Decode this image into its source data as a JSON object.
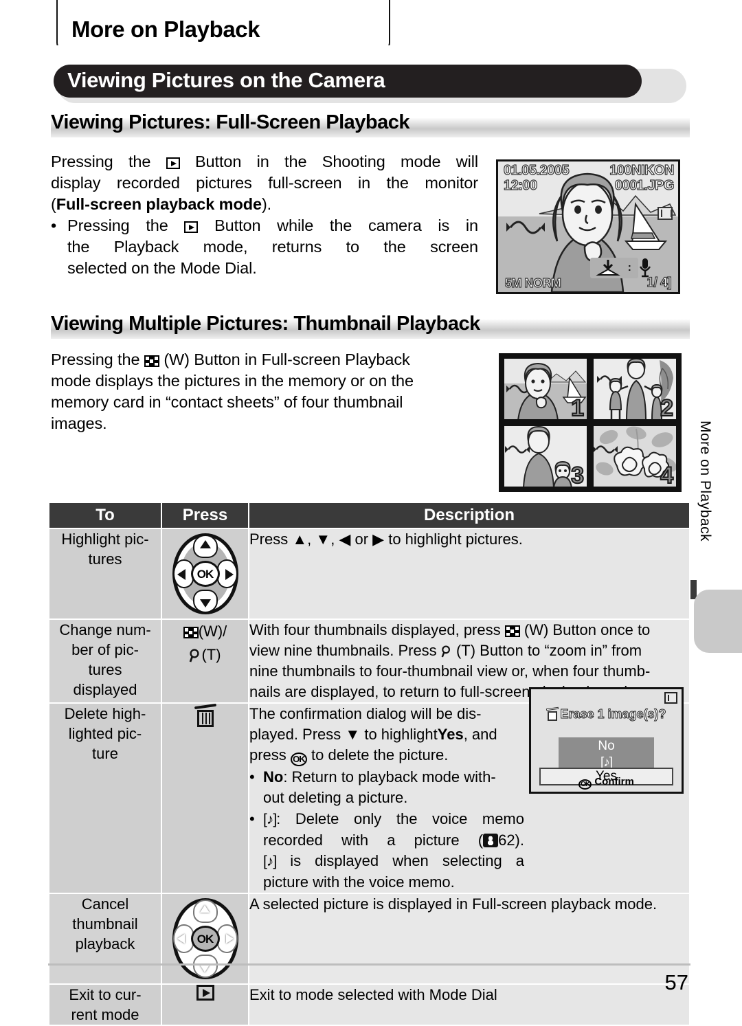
{
  "chapter_tab": {
    "label": "More on Playback"
  },
  "title_bar": {
    "text": "Viewing Pictures on the Camera"
  },
  "sections": [
    {
      "heading": "Viewing Pictures: Full-Screen Playback",
      "paragraph_1a": "Pressing the",
      "paragraph_1b": "Button in the Shooting mode will",
      "paragraph_2": "display recorded pictures full-screen in the monitor",
      "paragraph_3a": "(",
      "paragraph_3b": "Full-screen playback mode",
      "paragraph_3c": ").",
      "bullet_1a": "Pressing the",
      "bullet_1b": "Button while the camera is in",
      "bullet_2": "the Playback mode, returns to the screen",
      "bullet_3": "selected on the Mode Dial."
    },
    {
      "heading": "Viewing Multiple Pictures: Thumbnail Playback",
      "paragraph_1a": "Pressing the",
      "paragraph_1b": "(W) Button in Full-screen Playback",
      "paragraph_2": "mode displays the pictures in the memory or on the",
      "paragraph_3": "memory card in “contact sheets” of four thumbnail",
      "paragraph_4": "images."
    }
  ],
  "lcd_monitor": {
    "date": "01.05.2005",
    "time": "12:00",
    "folder": "100NIKON",
    "file": "0001.JPG",
    "quality": "5M NORM",
    "frame_counter": "1/  4]",
    "memory_icon": "internal-memory-icon",
    "save_icon": "save-to-card-icon",
    "mic_icon": "microphone-icon",
    "separator": ":"
  },
  "thumbnail_grid": {
    "numbers": [
      "1",
      "2",
      "3",
      "4"
    ]
  },
  "side_tab": {
    "label": "More on Playback"
  },
  "table": {
    "headers": [
      "To",
      "Press",
      "Description"
    ],
    "rows": [
      {
        "to": "Highlight pic-\ntures",
        "press_icon": "multi-selector-pad",
        "desc_pre": "Press",
        "desc_mid1": ",",
        "desc_mid2": ",",
        "desc_or": "or",
        "desc_post": "to highlight pictures."
      },
      {
        "to": "Change num-\nber of pic-\ntures\ndisplayed",
        "press_w": "(W)/",
        "press_t": "(T)",
        "desc_a": "With four thumbnails displayed, press",
        "desc_b": "(W) Button once to",
        "desc_c": "view nine thumbnails. Press",
        "desc_d": "(T) Button to “zoom in” from",
        "desc_e": "nine thumbnails to four-thumbnail view or, when four thumb-",
        "desc_f": "nails are displayed, to return to full-screen playback mode."
      },
      {
        "to": "Delete high-\nlighted pic-\nture",
        "press_icon": "trash-icon",
        "desc_l1": "The confirmation dialog will be dis-",
        "desc_l2a": "played. Press",
        "desc_l2b": "to highlight",
        "desc_l2c": "Yes",
        "desc_l2d": ", and",
        "desc_l3a": "press",
        "desc_l3b": "to delete the picture.",
        "bullet1_label": "No",
        "bullet1_a": ": Return to playback mode with-",
        "bullet1_b": "out deleting a picture.",
        "bullet2_icon": "[♪]",
        "bullet2_a": ": Delete only the voice memo",
        "bullet2_b": "recorded with a picture (",
        "bullet2_page": "62).",
        "bullet2_c": "is displayed when selecting a",
        "bullet2_d": "picture with the voice memo."
      },
      {
        "to": "Cancel\nthumbnail\nplayback",
        "press_icon": "multi-selector-pad-ok",
        "desc": "A selected picture is displayed in Full-screen playback mode."
      },
      {
        "to": "Exit to cur-\nrent mode",
        "press_icon": "playback-button-icon",
        "desc": "Exit to mode selected with Mode Dial"
      }
    ]
  },
  "erase_dialog": {
    "title": "Erase 1 image(s)?",
    "option_no": "No",
    "option_memo": "[♪]",
    "option_yes": "Yes",
    "confirm": "Confirm"
  },
  "page_number": "57"
}
